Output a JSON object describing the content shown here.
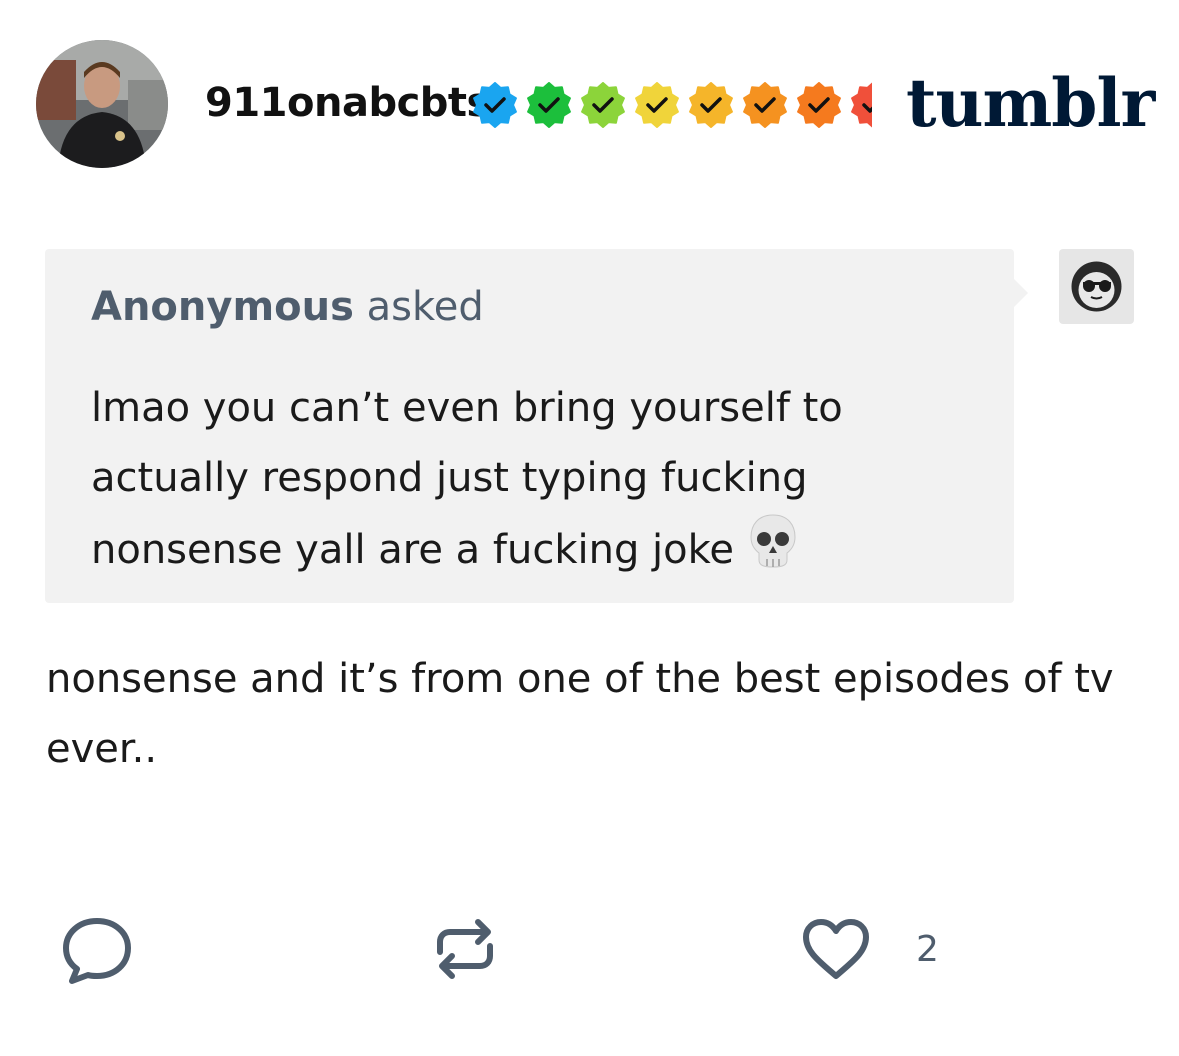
{
  "post": {
    "username": "911onabcbts",
    "badges": [
      {
        "color": "#1aa5f0",
        "icon": "check-badge-icon"
      },
      {
        "color": "#1cbf3c",
        "icon": "check-badge-icon"
      },
      {
        "color": "#8cd43a",
        "icon": "check-badge-icon"
      },
      {
        "color": "#f0d43a",
        "icon": "check-badge-icon"
      },
      {
        "color": "#f5b52a",
        "icon": "check-badge-icon"
      },
      {
        "color": "#f59220",
        "icon": "check-badge-icon"
      },
      {
        "color": "#f57a1e",
        "icon": "check-badge-icon"
      },
      {
        "color": "#f0503a",
        "icon": "check-badge-icon"
      }
    ],
    "logo": "tumblr"
  },
  "ask": {
    "asker_name": "Anonymous",
    "asked_label": "asked",
    "question": "lmao you can’t even bring yourself to actually respond just typing fucking nonsense yall are a fucking joke",
    "emoji": "skull-emoji"
  },
  "answer": {
    "text": "nonsense and it’s from one of the best episodes of tv ever.."
  },
  "actions": {
    "like_count": "2"
  },
  "colors": {
    "logo": "#001935",
    "ask_background": "#f2f2f2",
    "muted_text": "#4f5d6d"
  }
}
